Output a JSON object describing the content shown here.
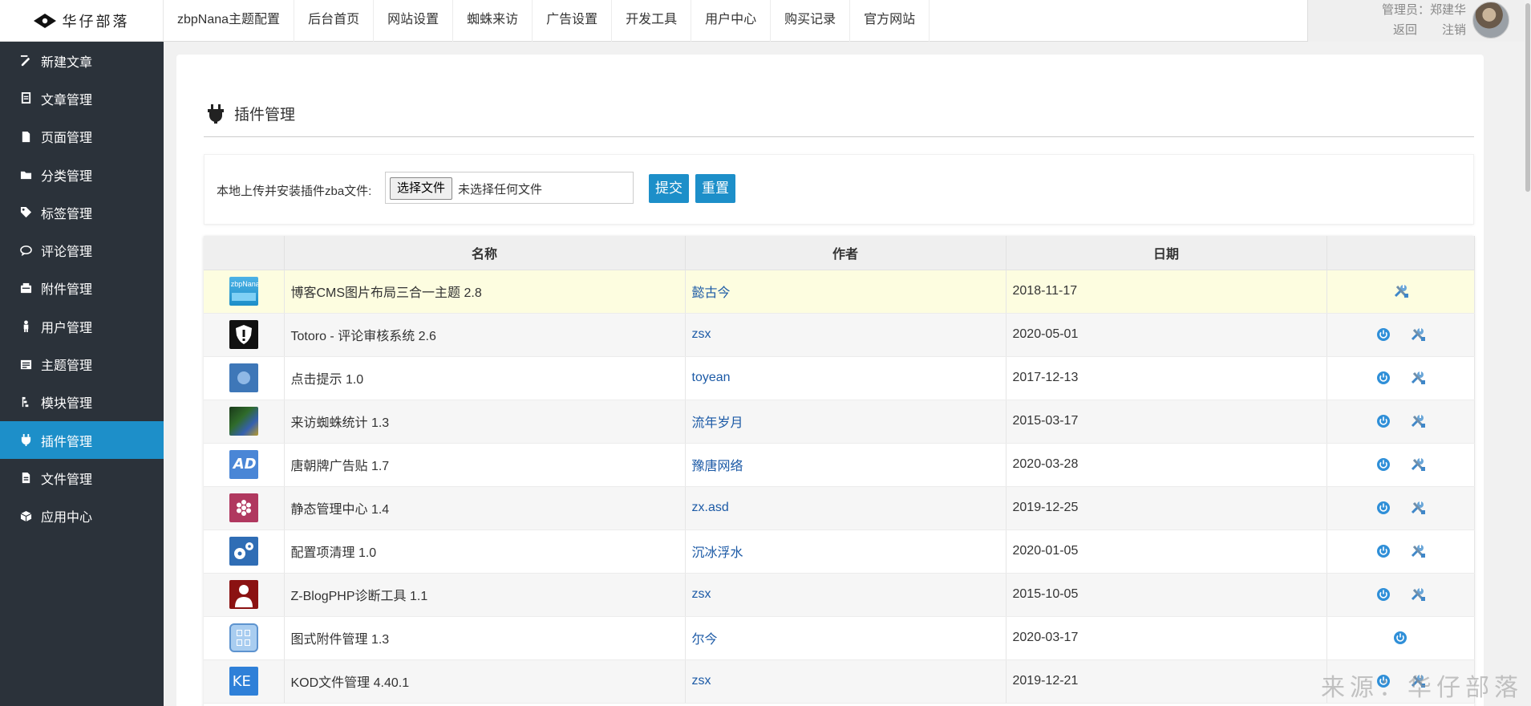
{
  "brand": {
    "logo_text": "华仔部落"
  },
  "topnav": [
    {
      "label": "zbpNana主题配置"
    },
    {
      "label": "后台首页"
    },
    {
      "label": "网站设置"
    },
    {
      "label": "蜘蛛来访"
    },
    {
      "label": "广告设置"
    },
    {
      "label": "开发工具"
    },
    {
      "label": "用户中心"
    },
    {
      "label": "购买记录"
    },
    {
      "label": "官方网站"
    }
  ],
  "admin": {
    "label": "管理员：郑建华",
    "back": "返回",
    "logout": "注销"
  },
  "sidebar": [
    {
      "label": "新建文章",
      "icon": "edit-icon"
    },
    {
      "label": "文章管理",
      "icon": "articles-icon"
    },
    {
      "label": "页面管理",
      "icon": "page-icon"
    },
    {
      "label": "分类管理",
      "icon": "folder-icon"
    },
    {
      "label": "标签管理",
      "icon": "tag-icon"
    },
    {
      "label": "评论管理",
      "icon": "comment-icon"
    },
    {
      "label": "附件管理",
      "icon": "attachment-icon"
    },
    {
      "label": "用户管理",
      "icon": "user-icon"
    },
    {
      "label": "主题管理",
      "icon": "theme-icon"
    },
    {
      "label": "模块管理",
      "icon": "module-icon"
    },
    {
      "label": "插件管理",
      "icon": "plugin-icon",
      "active": true
    },
    {
      "label": "文件管理",
      "icon": "file-icon"
    },
    {
      "label": "应用中心",
      "icon": "app-center-icon"
    }
  ],
  "page": {
    "title": "插件管理"
  },
  "upload": {
    "label": "本地上传并安装插件zba文件:",
    "choose_file": "选择文件",
    "file_status": "未选择任何文件",
    "submit": "提交",
    "reset": "重置"
  },
  "table": {
    "headers": [
      "名称",
      "作者",
      "日期"
    ],
    "rows": [
      {
        "name": "博客CMS图片布局三合一主题 2.8",
        "author": "懿古今",
        "date": "2018-11-17",
        "icon": "zbpnana-logo-icon",
        "power": false,
        "settings": true,
        "highlight": true
      },
      {
        "name": "Totoro - 评论审核系统 2.6",
        "author": "zsx",
        "date": "2020-05-01",
        "icon": "shield-icon",
        "power": true,
        "settings": true
      },
      {
        "name": "点击提示 1.0",
        "author": "toyean",
        "date": "2017-12-13",
        "icon": "click-tip-icon",
        "power": true,
        "settings": true
      },
      {
        "name": "来访蜘蛛统计 1.3",
        "author": "流年岁月",
        "date": "2015-03-17",
        "icon": "spider-stats-icon",
        "power": true,
        "settings": true
      },
      {
        "name": "唐朝牌广告贴 1.7",
        "author": "豫唐网络",
        "date": "2020-03-28",
        "icon": "ad-icon",
        "power": true,
        "settings": true
      },
      {
        "name": "静态管理中心 1.4",
        "author": "zx.asd",
        "date": "2019-12-25",
        "icon": "static-center-icon",
        "power": true,
        "settings": true
      },
      {
        "name": "配置项清理 1.0",
        "author": "沉冰浮水",
        "date": "2020-01-05",
        "icon": "gears-icon",
        "power": true,
        "settings": true
      },
      {
        "name": "Z-BlogPHP诊断工具 1.1",
        "author": "zsx",
        "date": "2015-10-05",
        "icon": "doctor-icon",
        "power": true,
        "settings": true
      },
      {
        "name": "图式附件管理 1.3",
        "author": "尔今",
        "date": "2020-03-17",
        "icon": "attachment-grid-icon",
        "power": true,
        "settings": false
      },
      {
        "name": "KOD文件管理 4.40.1",
        "author": "zsx",
        "date": "2019-12-21",
        "icon": "kod-icon",
        "power": true,
        "settings": true
      }
    ]
  },
  "watermark": "来源：华仔部落",
  "colors": {
    "sidebar_bg": "#2b323a",
    "accent": "#1d8fc9",
    "author_link": "#1c5aa6",
    "highlight_row": "#fdfde0"
  }
}
